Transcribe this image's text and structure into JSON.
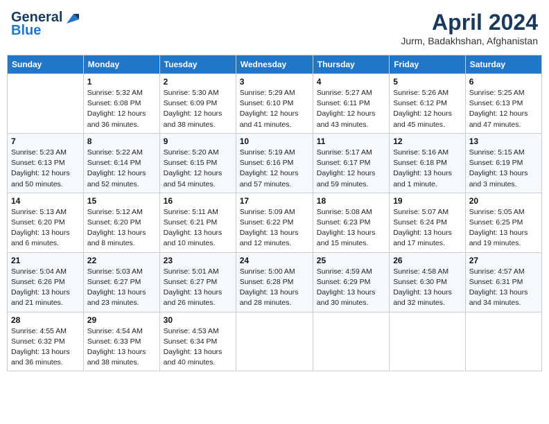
{
  "header": {
    "logo_general": "General",
    "logo_blue": "Blue",
    "month": "April 2024",
    "location": "Jurm, Badakhshan, Afghanistan"
  },
  "weekdays": [
    "Sunday",
    "Monday",
    "Tuesday",
    "Wednesday",
    "Thursday",
    "Friday",
    "Saturday"
  ],
  "weeks": [
    [
      {
        "day": "",
        "info": ""
      },
      {
        "day": "1",
        "info": "Sunrise: 5:32 AM\nSunset: 6:08 PM\nDaylight: 12 hours\nand 36 minutes."
      },
      {
        "day": "2",
        "info": "Sunrise: 5:30 AM\nSunset: 6:09 PM\nDaylight: 12 hours\nand 38 minutes."
      },
      {
        "day": "3",
        "info": "Sunrise: 5:29 AM\nSunset: 6:10 PM\nDaylight: 12 hours\nand 41 minutes."
      },
      {
        "day": "4",
        "info": "Sunrise: 5:27 AM\nSunset: 6:11 PM\nDaylight: 12 hours\nand 43 minutes."
      },
      {
        "day": "5",
        "info": "Sunrise: 5:26 AM\nSunset: 6:12 PM\nDaylight: 12 hours\nand 45 minutes."
      },
      {
        "day": "6",
        "info": "Sunrise: 5:25 AM\nSunset: 6:13 PM\nDaylight: 12 hours\nand 47 minutes."
      }
    ],
    [
      {
        "day": "7",
        "info": "Sunrise: 5:23 AM\nSunset: 6:13 PM\nDaylight: 12 hours\nand 50 minutes."
      },
      {
        "day": "8",
        "info": "Sunrise: 5:22 AM\nSunset: 6:14 PM\nDaylight: 12 hours\nand 52 minutes."
      },
      {
        "day": "9",
        "info": "Sunrise: 5:20 AM\nSunset: 6:15 PM\nDaylight: 12 hours\nand 54 minutes."
      },
      {
        "day": "10",
        "info": "Sunrise: 5:19 AM\nSunset: 6:16 PM\nDaylight: 12 hours\nand 57 minutes."
      },
      {
        "day": "11",
        "info": "Sunrise: 5:17 AM\nSunset: 6:17 PM\nDaylight: 12 hours\nand 59 minutes."
      },
      {
        "day": "12",
        "info": "Sunrise: 5:16 AM\nSunset: 6:18 PM\nDaylight: 13 hours\nand 1 minute."
      },
      {
        "day": "13",
        "info": "Sunrise: 5:15 AM\nSunset: 6:19 PM\nDaylight: 13 hours\nand 3 minutes."
      }
    ],
    [
      {
        "day": "14",
        "info": "Sunrise: 5:13 AM\nSunset: 6:20 PM\nDaylight: 13 hours\nand 6 minutes."
      },
      {
        "day": "15",
        "info": "Sunrise: 5:12 AM\nSunset: 6:20 PM\nDaylight: 13 hours\nand 8 minutes."
      },
      {
        "day": "16",
        "info": "Sunrise: 5:11 AM\nSunset: 6:21 PM\nDaylight: 13 hours\nand 10 minutes."
      },
      {
        "day": "17",
        "info": "Sunrise: 5:09 AM\nSunset: 6:22 PM\nDaylight: 13 hours\nand 12 minutes."
      },
      {
        "day": "18",
        "info": "Sunrise: 5:08 AM\nSunset: 6:23 PM\nDaylight: 13 hours\nand 15 minutes."
      },
      {
        "day": "19",
        "info": "Sunrise: 5:07 AM\nSunset: 6:24 PM\nDaylight: 13 hours\nand 17 minutes."
      },
      {
        "day": "20",
        "info": "Sunrise: 5:05 AM\nSunset: 6:25 PM\nDaylight: 13 hours\nand 19 minutes."
      }
    ],
    [
      {
        "day": "21",
        "info": "Sunrise: 5:04 AM\nSunset: 6:26 PM\nDaylight: 13 hours\nand 21 minutes."
      },
      {
        "day": "22",
        "info": "Sunrise: 5:03 AM\nSunset: 6:27 PM\nDaylight: 13 hours\nand 23 minutes."
      },
      {
        "day": "23",
        "info": "Sunrise: 5:01 AM\nSunset: 6:27 PM\nDaylight: 13 hours\nand 26 minutes."
      },
      {
        "day": "24",
        "info": "Sunrise: 5:00 AM\nSunset: 6:28 PM\nDaylight: 13 hours\nand 28 minutes."
      },
      {
        "day": "25",
        "info": "Sunrise: 4:59 AM\nSunset: 6:29 PM\nDaylight: 13 hours\nand 30 minutes."
      },
      {
        "day": "26",
        "info": "Sunrise: 4:58 AM\nSunset: 6:30 PM\nDaylight: 13 hours\nand 32 minutes."
      },
      {
        "day": "27",
        "info": "Sunrise: 4:57 AM\nSunset: 6:31 PM\nDaylight: 13 hours\nand 34 minutes."
      }
    ],
    [
      {
        "day": "28",
        "info": "Sunrise: 4:55 AM\nSunset: 6:32 PM\nDaylight: 13 hours\nand 36 minutes."
      },
      {
        "day": "29",
        "info": "Sunrise: 4:54 AM\nSunset: 6:33 PM\nDaylight: 13 hours\nand 38 minutes."
      },
      {
        "day": "30",
        "info": "Sunrise: 4:53 AM\nSunset: 6:34 PM\nDaylight: 13 hours\nand 40 minutes."
      },
      {
        "day": "",
        "info": ""
      },
      {
        "day": "",
        "info": ""
      },
      {
        "day": "",
        "info": ""
      },
      {
        "day": "",
        "info": ""
      }
    ]
  ]
}
